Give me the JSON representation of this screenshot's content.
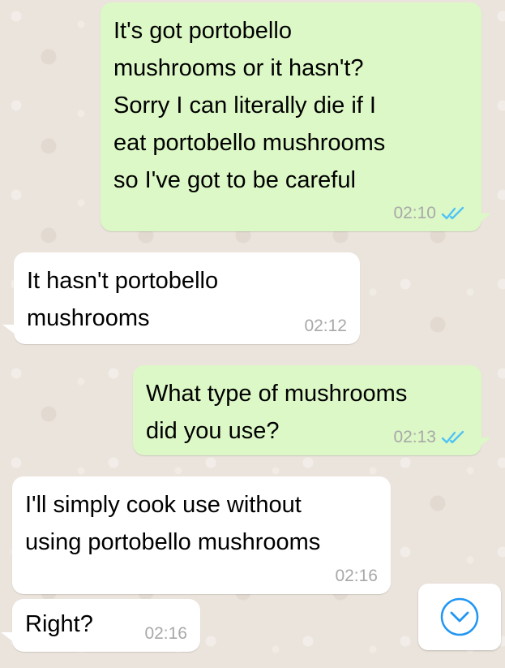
{
  "colors": {
    "outgoing_bubble": "#dcf8c6",
    "incoming_bubble": "#ffffff",
    "timestamp": "#a8a8a8",
    "read_ticks": "#4fc3f7",
    "scroll_button_icon": "#2196f3"
  },
  "messages": [
    {
      "direction": "outgoing",
      "text": "It's got portobello\nmushrooms or it hasn't?\nSorry I can literally die if I\neat portobello mushrooms\nso I've got to be careful",
      "time": "02:10",
      "status_icon": "double-check-read-icon"
    },
    {
      "direction": "incoming",
      "text": "It hasn't portobello\nmushrooms",
      "time": "02:12"
    },
    {
      "direction": "outgoing",
      "text": "What type of mushrooms\ndid you use?",
      "time": "02:13",
      "status_icon": "double-check-read-icon"
    },
    {
      "direction": "incoming",
      "text": "I'll simply cook use without\nusing portobello mushrooms",
      "time": "02:16"
    },
    {
      "direction": "incoming",
      "text": "Right?",
      "time": "02:16"
    }
  ],
  "scroll_button": {
    "icon": "chevron-down-circle-icon"
  }
}
